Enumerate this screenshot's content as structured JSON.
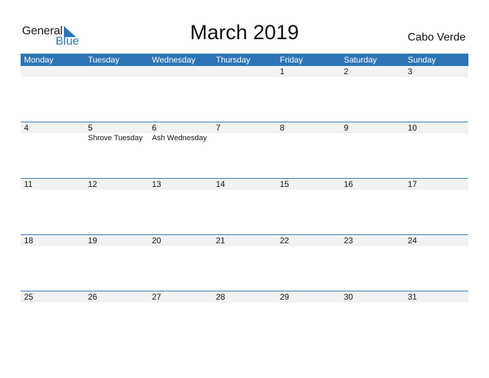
{
  "logo": {
    "word1": "General",
    "word2": "Blue"
  },
  "title": "March 2019",
  "country": "Cabo Verde",
  "colors": {
    "accent": "#2E74B5",
    "strip": "#f2f2f2"
  },
  "weekdays": [
    "Monday",
    "Tuesday",
    "Wednesday",
    "Thursday",
    "Friday",
    "Saturday",
    "Sunday"
  ],
  "weeks": [
    {
      "days": [
        "",
        "",
        "",
        "",
        "1",
        "2",
        "3"
      ],
      "events": [
        "",
        "",
        "",
        "",
        "",
        "",
        ""
      ]
    },
    {
      "days": [
        "4",
        "5",
        "6",
        "7",
        "8",
        "9",
        "10"
      ],
      "events": [
        "",
        "Shrove Tuesday",
        "Ash Wednesday",
        "",
        "",
        "",
        ""
      ]
    },
    {
      "days": [
        "11",
        "12",
        "13",
        "14",
        "15",
        "16",
        "17"
      ],
      "events": [
        "",
        "",
        "",
        "",
        "",
        "",
        ""
      ]
    },
    {
      "days": [
        "18",
        "19",
        "20",
        "21",
        "22",
        "23",
        "24"
      ],
      "events": [
        "",
        "",
        "",
        "",
        "",
        "",
        ""
      ]
    },
    {
      "days": [
        "25",
        "26",
        "27",
        "28",
        "29",
        "30",
        "31"
      ],
      "events": [
        "",
        "",
        "",
        "",
        "",
        "",
        ""
      ]
    }
  ]
}
